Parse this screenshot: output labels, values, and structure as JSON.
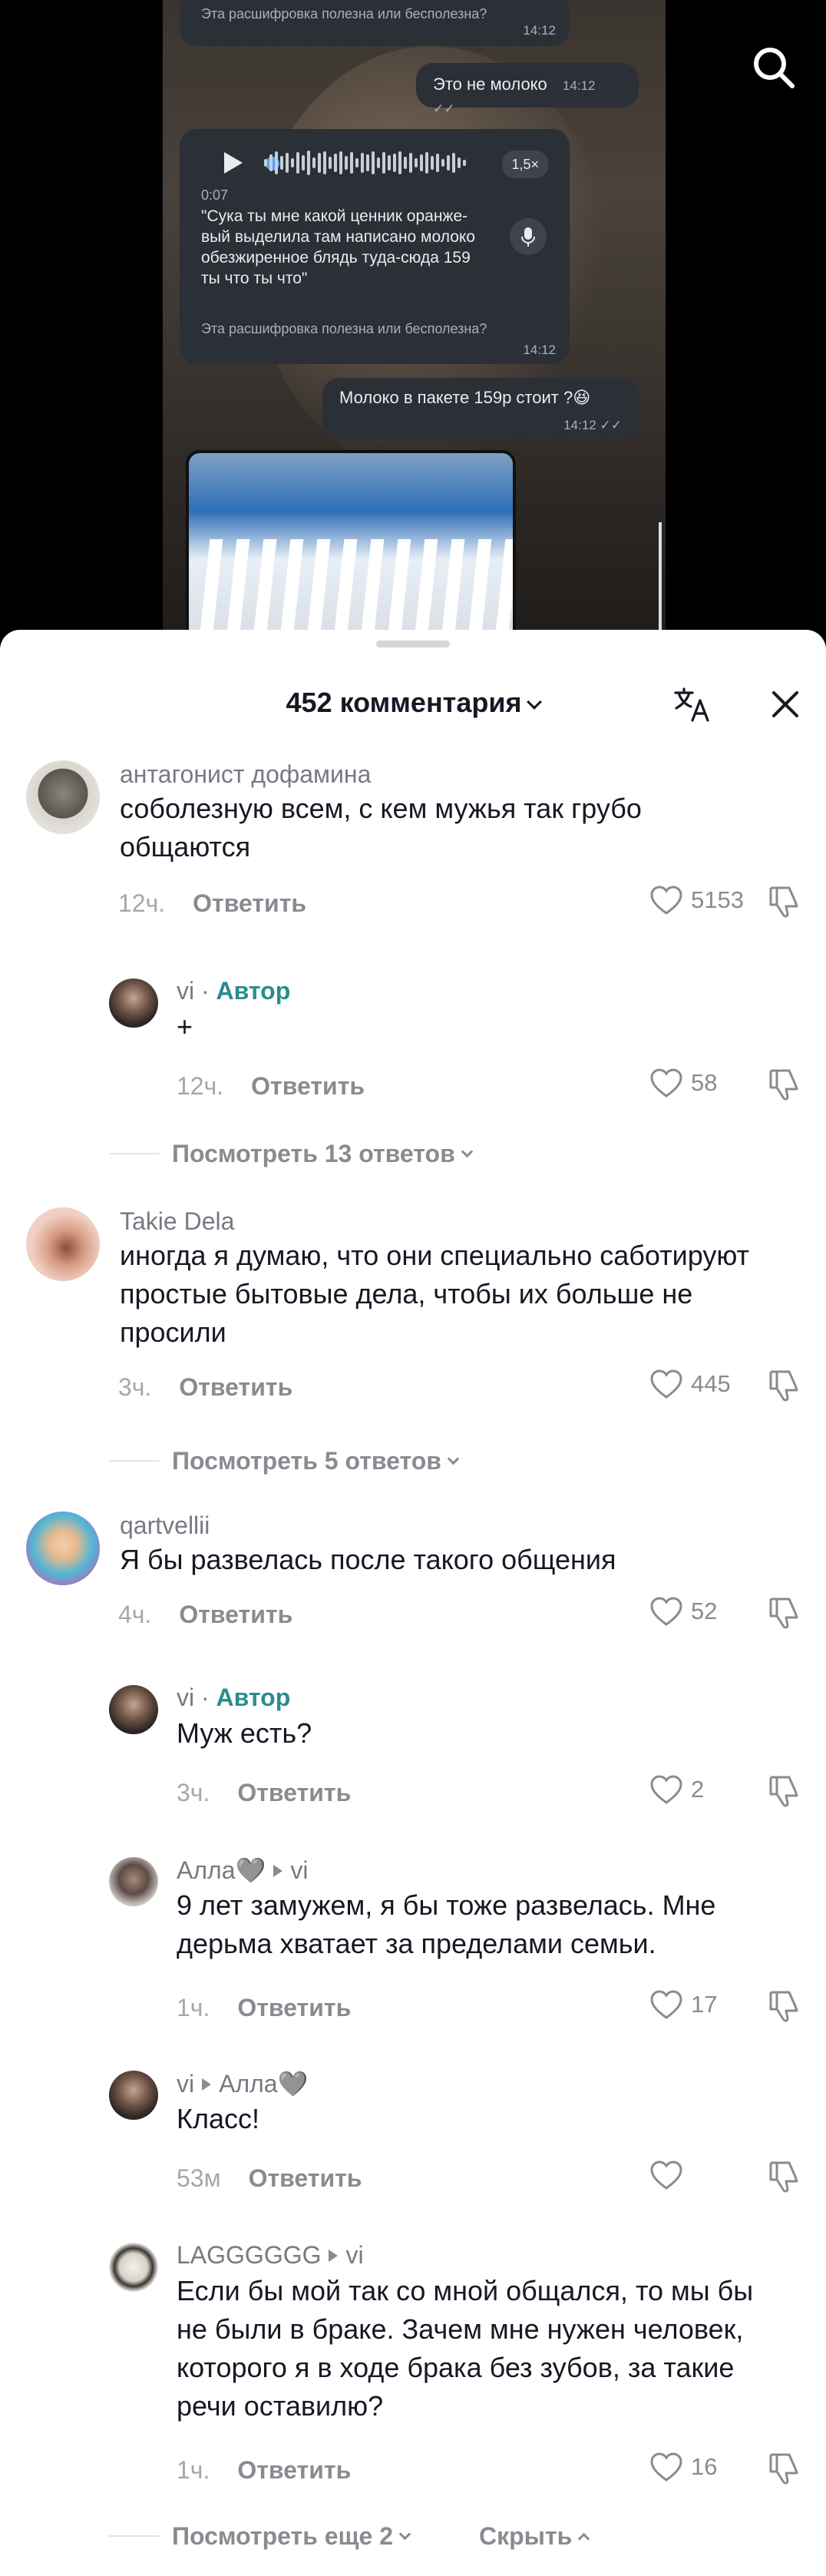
{
  "video": {
    "chat": {
      "top_notice": "Эта расшифровка полезна или бесполезна?",
      "top_notice_time": "14:12",
      "msg_out_1": "Это не молоко",
      "msg_out_1_time": "14:12",
      "voice_duration": "0:07",
      "voice_speed": "1,5×",
      "voice_transcript": "\"Сука ты мне какой ценник оранже-вый выделила там написано молоко обезжиренное блядь туда-сюда 159 ты что ты что\"",
      "voice_notice": "Эта расшифровка полезна или бесполезна?",
      "voice_time": "14:12",
      "msg_out_2": "Молоко в пакете 159р стоит ?😆",
      "msg_out_2_time": "14:12"
    },
    "icons": {
      "search": "search-icon"
    }
  },
  "sheet": {
    "title": "452 комментария",
    "icons": {
      "translate": "translate-icon",
      "close": "close-icon"
    }
  },
  "comments": [
    {
      "user": "антагонист дофамина",
      "text": "соболезную всем, с кем мужья так грубо общаются",
      "time": "12ч.",
      "reply": "Ответить",
      "likes": "5153"
    },
    {
      "user": "vi",
      "author": "Автор",
      "text": "+",
      "time": "12ч.",
      "reply": "Ответить",
      "likes": "58"
    },
    {
      "view_more": "Посмотреть 13 ответов"
    },
    {
      "user": "Takie Dela",
      "text": "иногда я думаю, что они специально саботируют простые бытовые дела, чтобы их больше не просили",
      "time": "3ч.",
      "reply": "Ответить",
      "likes": "445"
    },
    {
      "view_more": "Посмотреть 5 ответов"
    },
    {
      "user": "qartvellii",
      "text": "Я бы развелась после такого общения",
      "time": "4ч.",
      "reply": "Ответить",
      "likes": "52"
    },
    {
      "user": "vi",
      "author": "Автор",
      "text": "Муж есть?",
      "time": "3ч.",
      "reply": "Ответить",
      "likes": "2"
    },
    {
      "user": "Алла🩶",
      "to": "vi",
      "text": "9 лет замужем, я бы тоже развелась. Мне дерьма хватает за пределами семьи.",
      "time": "1ч.",
      "reply": "Ответить",
      "likes": "17"
    },
    {
      "user": "vi",
      "to": "Алла🩶",
      "text": "Класс!",
      "time": "53м",
      "reply": "Ответить",
      "likes": ""
    },
    {
      "user": "LAGGGGGG",
      "to": "vi",
      "text": "Если бы мой так со мной общался, то мы бы не были в браке. Зачем мне нужен человек, которого я в ходе брака без зубов, за такие речи оставилю?",
      "time": "1ч.",
      "reply": "Ответить",
      "likes": "16"
    },
    {
      "view_more": "Посмотреть еще 2",
      "hide": "Скрыть"
    }
  ],
  "colors": {
    "author": "#2a8d8f",
    "muted": "#8a8b91",
    "text": "#161823"
  }
}
